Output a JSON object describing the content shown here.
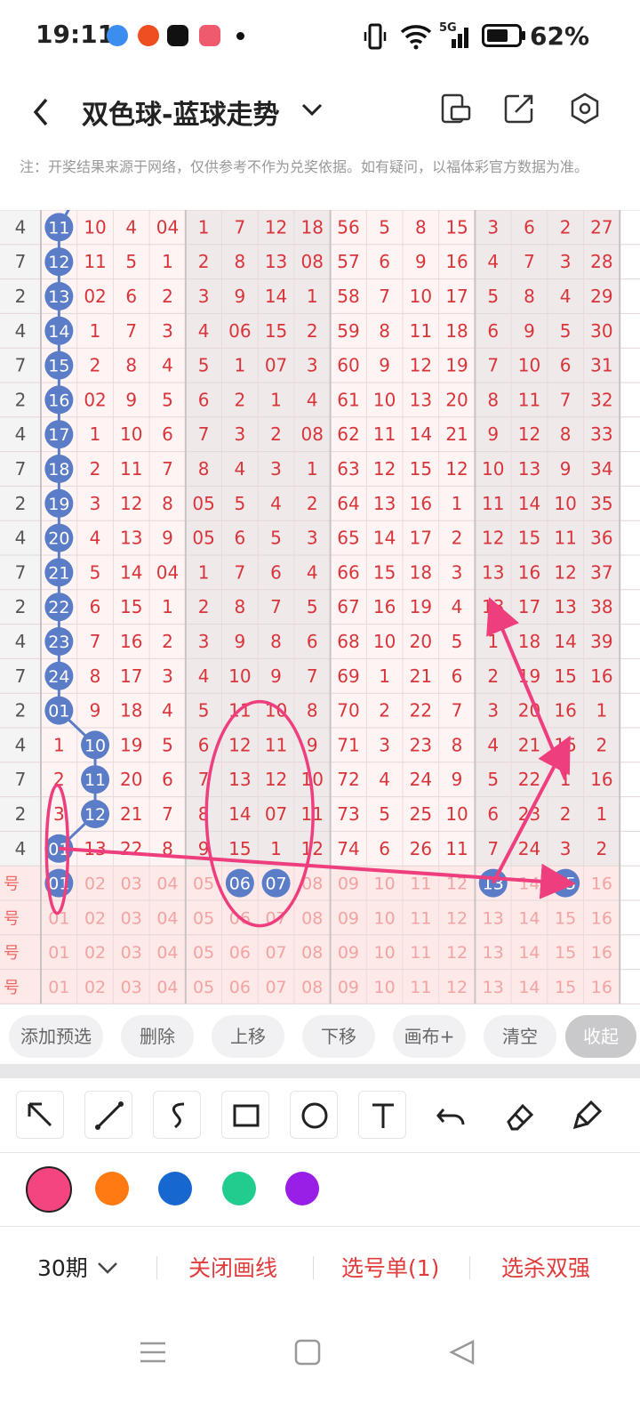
{
  "status_bar": {
    "time": "19:11",
    "network": "5G",
    "battery": "62%"
  },
  "header": {
    "title": "双色球-蓝球走势"
  },
  "notice": "注：开奖结果来源于网络，仅供参考不作为兑奖依据。如有疑问，以福体彩官方数据为准。",
  "table": {
    "rows": [
      {
        "lead": "4",
        "cells": [
          "11",
          "10",
          "4",
          "04",
          "1",
          "7",
          "12",
          "18",
          "56",
          "5",
          "8",
          "15",
          "3",
          "6",
          "2",
          "27"
        ]
      },
      {
        "lead": "7",
        "cells": [
          "12",
          "11",
          "5",
          "1",
          "2",
          "8",
          "13",
          "08",
          "57",
          "6",
          "9",
          "16",
          "4",
          "7",
          "3",
          "28"
        ]
      },
      {
        "lead": "2",
        "cells": [
          "13",
          "02",
          "6",
          "2",
          "3",
          "9",
          "14",
          "1",
          "58",
          "7",
          "10",
          "17",
          "5",
          "8",
          "4",
          "29"
        ]
      },
      {
        "lead": "4",
        "cells": [
          "14",
          "1",
          "7",
          "3",
          "4",
          "06",
          "15",
          "2",
          "59",
          "8",
          "11",
          "18",
          "6",
          "9",
          "5",
          "30"
        ]
      },
      {
        "lead": "7",
        "cells": [
          "15",
          "2",
          "8",
          "4",
          "5",
          "1",
          "07",
          "3",
          "60",
          "9",
          "12",
          "19",
          "7",
          "10",
          "6",
          "31"
        ]
      },
      {
        "lead": "2",
        "cells": [
          "16",
          "02",
          "9",
          "5",
          "6",
          "2",
          "1",
          "4",
          "61",
          "10",
          "13",
          "20",
          "8",
          "11",
          "7",
          "32"
        ]
      },
      {
        "lead": "4",
        "cells": [
          "17",
          "1",
          "10",
          "6",
          "7",
          "3",
          "2",
          "08",
          "62",
          "11",
          "14",
          "21",
          "9",
          "12",
          "8",
          "33"
        ]
      },
      {
        "lead": "7",
        "cells": [
          "18",
          "2",
          "11",
          "7",
          "8",
          "4",
          "3",
          "1",
          "63",
          "12",
          "15",
          "12",
          "10",
          "13",
          "9",
          "34"
        ]
      },
      {
        "lead": "2",
        "cells": [
          "19",
          "3",
          "12",
          "8",
          "05",
          "5",
          "4",
          "2",
          "64",
          "13",
          "16",
          "1",
          "11",
          "14",
          "10",
          "35"
        ]
      },
      {
        "lead": "4",
        "cells": [
          "20",
          "4",
          "13",
          "9",
          "05",
          "6",
          "5",
          "3",
          "65",
          "14",
          "17",
          "2",
          "12",
          "15",
          "11",
          "36"
        ]
      },
      {
        "lead": "7",
        "cells": [
          "21",
          "5",
          "14",
          "04",
          "1",
          "7",
          "6",
          "4",
          "66",
          "15",
          "18",
          "3",
          "13",
          "16",
          "12",
          "37"
        ]
      },
      {
        "lead": "2",
        "cells": [
          "22",
          "6",
          "15",
          "1",
          "2",
          "8",
          "7",
          "5",
          "67",
          "16",
          "19",
          "4",
          "13",
          "17",
          "13",
          "38"
        ]
      },
      {
        "lead": "4",
        "cells": [
          "23",
          "7",
          "16",
          "2",
          "3",
          "9",
          "8",
          "6",
          "68",
          "10",
          "20",
          "5",
          "1",
          "18",
          "14",
          "39"
        ]
      },
      {
        "lead": "7",
        "cells": [
          "24",
          "8",
          "17",
          "3",
          "4",
          "10",
          "9",
          "7",
          "69",
          "1",
          "21",
          "6",
          "2",
          "19",
          "15",
          "16"
        ]
      },
      {
        "lead": "2",
        "cells": [
          "01",
          "9",
          "18",
          "4",
          "5",
          "11",
          "10",
          "8",
          "70",
          "2",
          "22",
          "7",
          "3",
          "20",
          "16",
          "1"
        ]
      },
      {
        "lead": "4",
        "cells": [
          "1",
          "10",
          "19",
          "5",
          "6",
          "12",
          "11",
          "9",
          "71",
          "3",
          "23",
          "8",
          "4",
          "21",
          "15",
          "2"
        ]
      },
      {
        "lead": "7",
        "cells": [
          "2",
          "11",
          "20",
          "6",
          "7",
          "13",
          "12",
          "10",
          "72",
          "4",
          "24",
          "9",
          "5",
          "22",
          "1",
          "16"
        ]
      },
      {
        "lead": "2",
        "cells": [
          "3",
          "12",
          "21",
          "7",
          "8",
          "14",
          "07",
          "11",
          "73",
          "5",
          "25",
          "10",
          "6",
          "23",
          "2",
          "1"
        ]
      },
      {
        "lead": "4",
        "cells": [
          "01",
          "13",
          "22",
          "8",
          "9",
          "15",
          "1",
          "12",
          "74",
          "6",
          "26",
          "11",
          "7",
          "24",
          "3",
          "2"
        ]
      }
    ],
    "select_rows": [
      {
        "lead": "号",
        "cells": [
          "01",
          "02",
          "03",
          "04",
          "05",
          "06",
          "07",
          "08",
          "09",
          "10",
          "11",
          "12",
          "13",
          "14",
          "15",
          "16"
        ]
      },
      {
        "lead": "号",
        "cells": [
          "01",
          "02",
          "03",
          "04",
          "05",
          "06",
          "07",
          "08",
          "09",
          "10",
          "11",
          "12",
          "13",
          "14",
          "15",
          "16"
        ]
      },
      {
        "lead": "号",
        "cells": [
          "01",
          "02",
          "03",
          "04",
          "05",
          "06",
          "07",
          "08",
          "09",
          "10",
          "11",
          "12",
          "13",
          "14",
          "15",
          "16"
        ]
      },
      {
        "lead": "号",
        "cells": [
          "01",
          "02",
          "03",
          "04",
          "05",
          "06",
          "07",
          "08",
          "09",
          "10",
          "11",
          "12",
          "13",
          "14",
          "15",
          "16"
        ]
      }
    ],
    "selected_balls": [
      "01",
      "06",
      "07",
      "13",
      "15"
    ]
  },
  "actions": [
    "添加预选",
    "删除",
    "上移",
    "下移",
    "画布+",
    "清空",
    "收起"
  ],
  "tools": [
    "arrow-tool-icon",
    "line-tool-icon",
    "curve-tool-icon",
    "rect-tool-icon",
    "circle-tool-icon",
    "text-tool-icon",
    "undo-icon",
    "eraser-icon",
    "clear-canvas-icon"
  ],
  "colors": [
    "#f44580",
    "#ff7a12",
    "#1767d0",
    "#22cc8e",
    "#9a1fe6"
  ],
  "footer": {
    "period": "30期",
    "close_draw": "关闭画线",
    "ticket": "选号单(1)",
    "kill": "选杀双强"
  },
  "theme": {
    "red_text": "#d8353b",
    "ball_blue": "#5b7cc6",
    "pink_annotation": "#ee3e7d"
  }
}
